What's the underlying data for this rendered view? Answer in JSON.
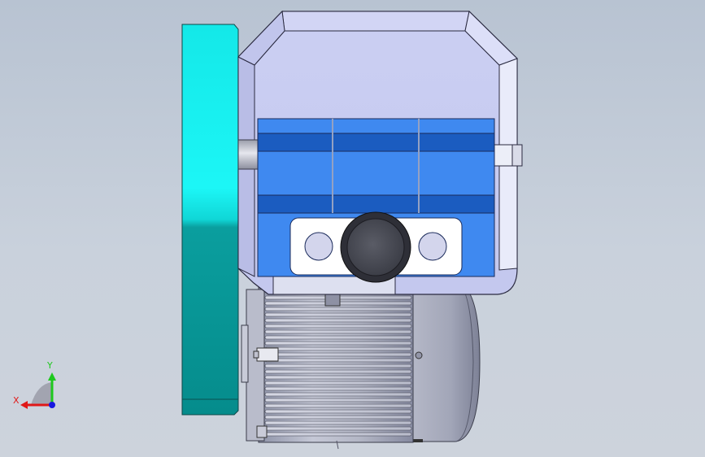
{
  "viewport": {
    "background_top": "#b8c3d2",
    "background_bottom": "#cdd3dc"
  },
  "colors": {
    "coupling_light": "#16f0f0",
    "coupling_dark": "#079696",
    "gearbox_housing": "#c9cdf2",
    "gearbox_outline": "#2a2a40",
    "block_light": "#3f89f0",
    "block_band": "#1b5cc0",
    "motor_body": "#9ea3b8",
    "axis_x": "#e01818",
    "axis_y": "#1ec81e",
    "axis_z": "#1818e0"
  },
  "triad": {
    "x_label": "X",
    "y_label": "Y"
  }
}
